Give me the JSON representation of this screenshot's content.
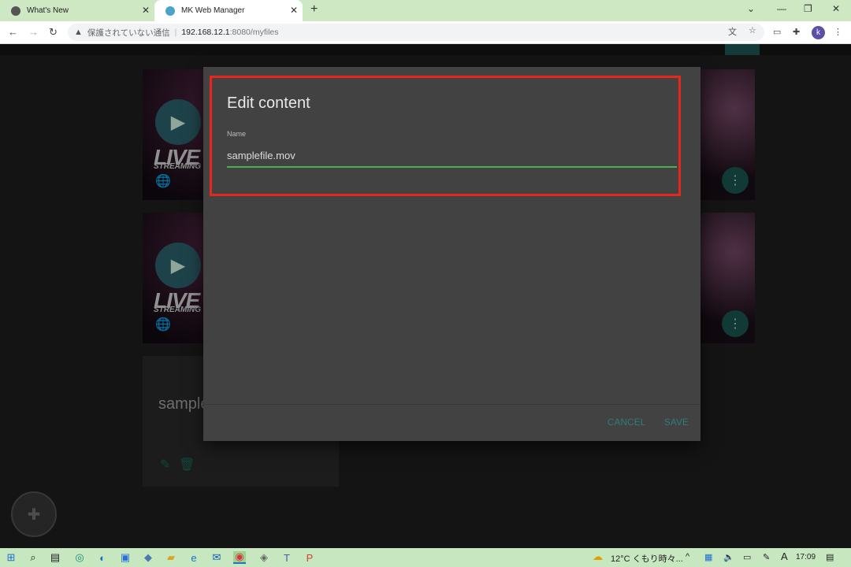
{
  "browser": {
    "tabs": [
      {
        "title": "What's New",
        "icon": "chrome-icon"
      },
      {
        "title": "MK Web Manager",
        "icon": "mk-favicon",
        "active": true
      }
    ],
    "address": {
      "security_text": "保護されていない通信",
      "host": "192.168.12.1",
      "path": ":8080/myfiles"
    },
    "profile_initial": "k"
  },
  "page": {
    "visible_card_title": "sample",
    "live_text": "LIVE",
    "streaming_text": "STREAMING"
  },
  "dialog": {
    "title": "Edit content",
    "field_label": "Name",
    "field_value": "samplefile.mov",
    "cancel_label": "CANCEL",
    "save_label": "SAVE",
    "highlight_color": "#e8261c",
    "accent_color": "#4caf50"
  },
  "taskbar": {
    "weather": "12°C くもり時々...",
    "ime": "A",
    "time": "17:09"
  }
}
